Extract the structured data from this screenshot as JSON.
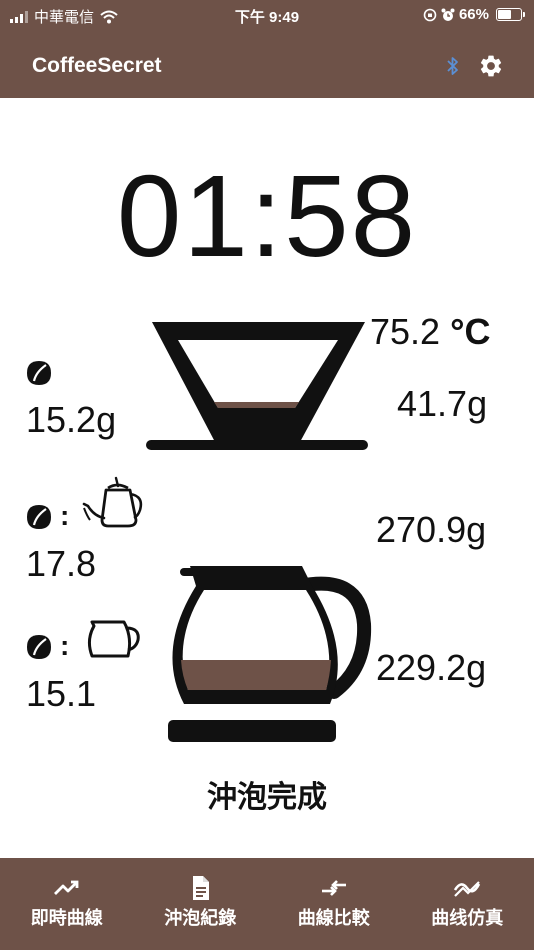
{
  "status_bar": {
    "carrier": "中華電信",
    "time": "下午 9:49",
    "battery_percent": "66%",
    "battery_level": 0.66
  },
  "app_bar": {
    "title": "CoffeeSecret",
    "icons": [
      "bluetooth-icon",
      "gear-icon"
    ]
  },
  "timer": "01:58",
  "dripper": {
    "temperature_value": "75.2",
    "temperature_unit": "°C",
    "weight": "41.7g"
  },
  "left_panel": {
    "bean_weight": "15.2g",
    "water_ratio": "17.8",
    "coffee_ratio": "15.1"
  },
  "right_panel": {
    "water_weight": "270.9g",
    "coffee_weight": "229.2g"
  },
  "brew_status": "沖泡完成",
  "bottom_nav": {
    "items": [
      {
        "label": "即時曲線",
        "icon": "trending-up-icon"
      },
      {
        "label": "沖泡紀錄",
        "icon": "document-icon"
      },
      {
        "label": "曲線比較",
        "icon": "compare-arrows-icon"
      },
      {
        "label": "曲线仿真",
        "icon": "simulate-curve-icon"
      }
    ]
  },
  "colors": {
    "brand": "#6e5248",
    "coffee": "#6e5248",
    "text": "#111111"
  }
}
